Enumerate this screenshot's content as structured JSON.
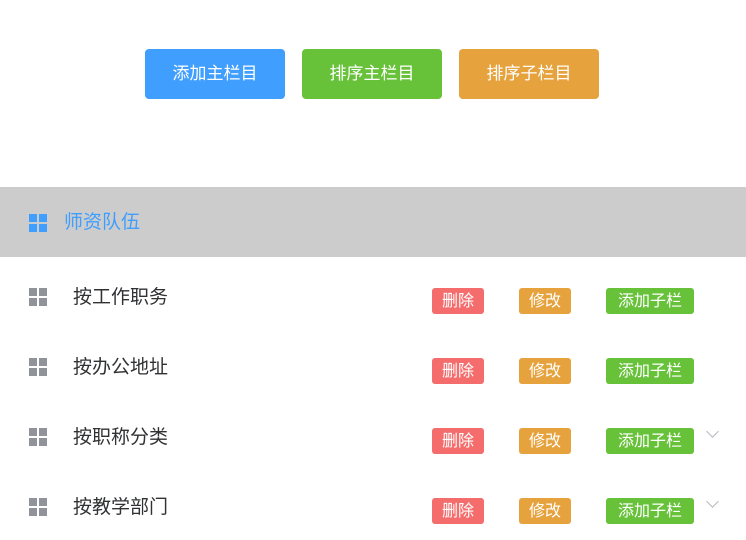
{
  "toolbar": {
    "add_main": "添加主栏目",
    "sort_main": "排序主栏目",
    "sort_sub": "排序子栏目"
  },
  "section": {
    "title": "师资队伍",
    "icon": "grid-icon",
    "accent": "#409eff"
  },
  "rows": [
    {
      "label": "按工作职务",
      "delete": "删除",
      "edit": "修改",
      "add_sub": "添加子栏",
      "expandable": false
    },
    {
      "label": "按办公地址",
      "delete": "删除",
      "edit": "修改",
      "add_sub": "添加子栏",
      "expandable": false
    },
    {
      "label": "按职称分类",
      "delete": "删除",
      "edit": "修改",
      "add_sub": "添加子栏",
      "expandable": true
    },
    {
      "label": "按教学部门",
      "delete": "删除",
      "edit": "修改",
      "add_sub": "添加子栏",
      "expandable": true
    }
  ],
  "colors": {
    "primary": "#409eff",
    "success": "#67c23a",
    "warning": "#e6a23c",
    "danger": "#f56c6c",
    "header_bg": "#cccccc"
  }
}
